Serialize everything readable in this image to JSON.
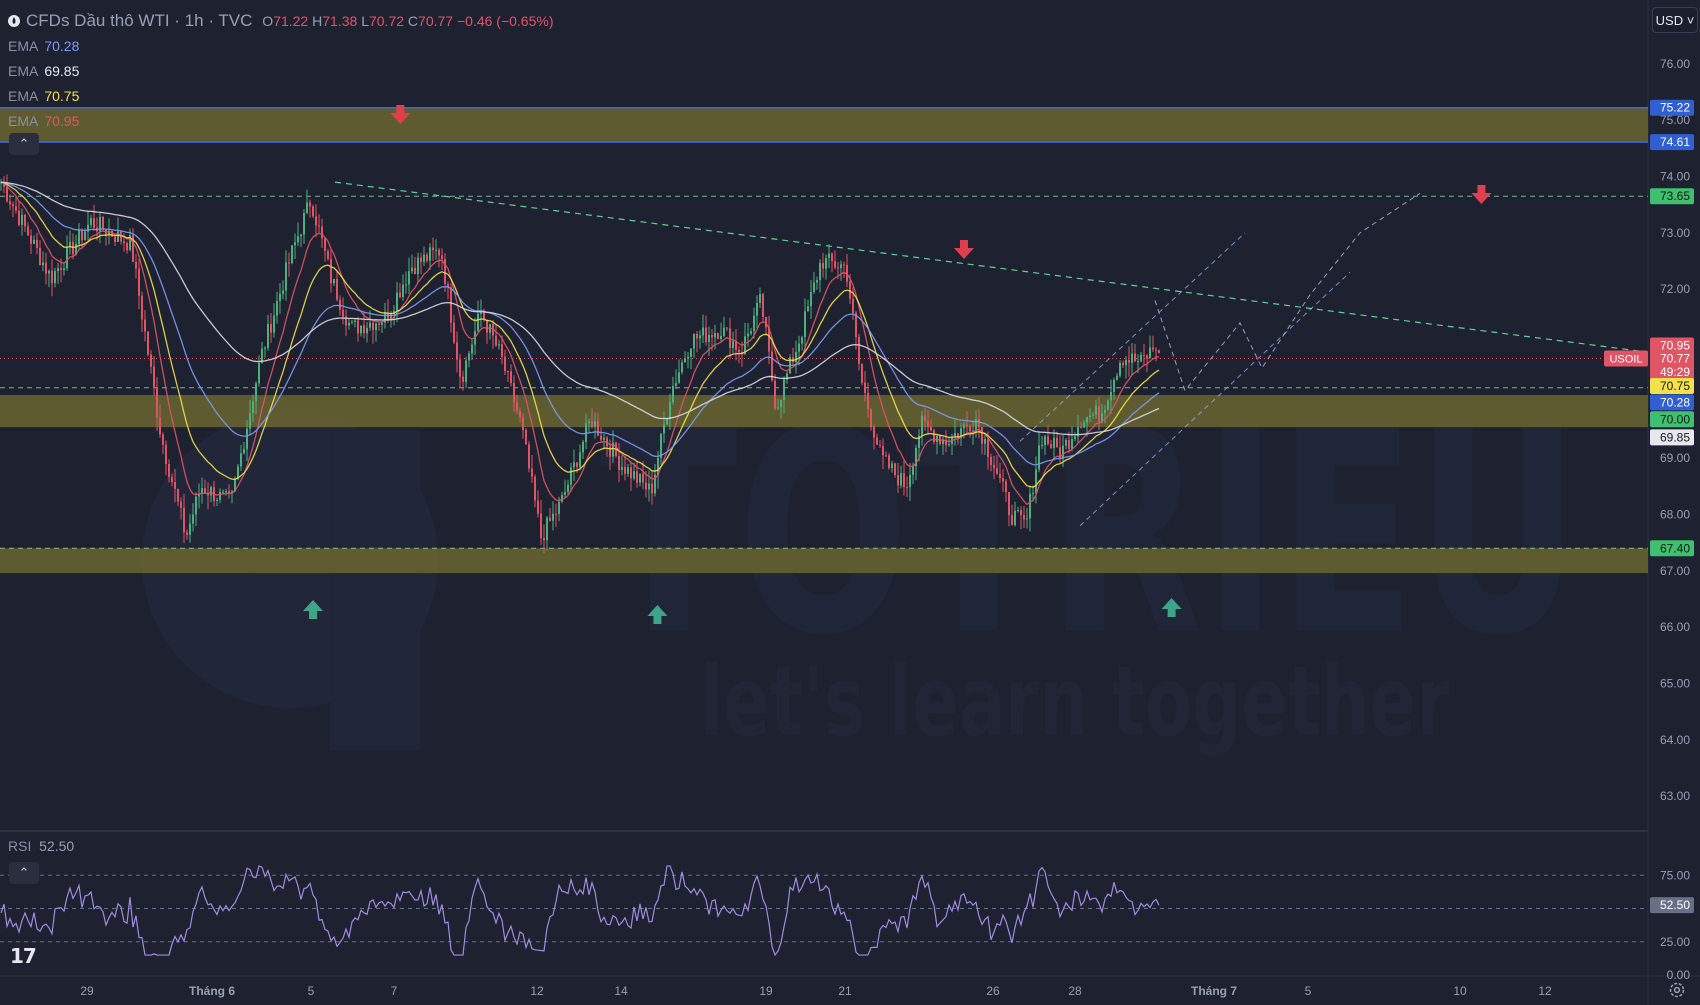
{
  "header": {
    "symbol_title": "CFDs Dầu thô WTI · 1h · TVC",
    "open_label": "O",
    "open_value": "71.22",
    "high_label": "H",
    "high_value": "71.38",
    "low_label": "L",
    "low_value": "70.72",
    "close_label": "C",
    "close_value": "70.77",
    "change": "−0.46 (−0.65%)"
  },
  "ema_legend": [
    {
      "label": "EMA",
      "value": "70.28",
      "color": "#7b9cf0"
    },
    {
      "label": "EMA",
      "value": "69.85",
      "color": "#e6e8f0"
    },
    {
      "label": "EMA",
      "value": "70.75",
      "color": "#f3e04b"
    },
    {
      "label": "EMA",
      "value": "70.95",
      "color": "#e05566"
    }
  ],
  "currency_button": "USD ˅",
  "collapse_icon": "chevron-up-icon",
  "rsi": {
    "label": "RSI",
    "value": "52.50"
  },
  "logo_text": "17",
  "watermark": {
    "brand": "TOTRIEU",
    "slogan": "let's learn together"
  },
  "colors": {
    "background": "#1e2130",
    "zone": "#6b6530",
    "up_candle": "#4caf7d",
    "down_candle": "#e05566",
    "ema_fast": "#e05566",
    "ema_mid": "#f3e04b",
    "ema_slow": "#7b9cf0",
    "ema_long": "#d8dae4",
    "trend_line": "#5fd09a",
    "arrow_up": "#3fa58a",
    "arrow_down": "#e0404e"
  },
  "chart_data": [
    {
      "type": "candlestick",
      "title": "CFDs Dầu thô WTI · 1h · TVC",
      "y_ticks": [
        "76.00",
        "75.00",
        "74.00",
        "73.00",
        "72.00",
        "71.00",
        "70.00",
        "69.00",
        "68.00",
        "67.00",
        "66.00",
        "65.00",
        "64.00",
        "63.00"
      ],
      "ylim": [
        62.4,
        76.6
      ],
      "x_ticks": [
        "29",
        "Tháng 6",
        "5",
        "7",
        "12",
        "14",
        "19",
        "21",
        "26",
        "28",
        "Tháng 7",
        "5",
        "10",
        "12"
      ],
      "close_anchors": [
        [
          0,
          73.9
        ],
        [
          50,
          72.2
        ],
        [
          90,
          73.2
        ],
        [
          130,
          72.8
        ],
        [
          160,
          69.4
        ],
        [
          185,
          67.6
        ],
        [
          200,
          68.5
        ],
        [
          230,
          68.2
        ],
        [
          260,
          70.8
        ],
        [
          290,
          72.6
        ],
        [
          310,
          73.6
        ],
        [
          330,
          72.2
        ],
        [
          350,
          71.3
        ],
        [
          385,
          71.5
        ],
        [
          410,
          72.4
        ],
        [
          440,
          72.7
        ],
        [
          460,
          70.4
        ],
        [
          480,
          71.6
        ],
        [
          500,
          70.8
        ],
        [
          520,
          69.6
        ],
        [
          540,
          67.6
        ],
        [
          560,
          68.2
        ],
        [
          590,
          69.7
        ],
        [
          620,
          68.9
        ],
        [
          650,
          68.4
        ],
        [
          670,
          70.2
        ],
        [
          690,
          71.1
        ],
        [
          720,
          71.3
        ],
        [
          740,
          70.9
        ],
        [
          760,
          71.8
        ],
        [
          775,
          69.9
        ],
        [
          800,
          71.2
        ],
        [
          820,
          72.5
        ],
        [
          845,
          72.4
        ],
        [
          860,
          70.4
        ],
        [
          880,
          69.0
        ],
        [
          905,
          68.5
        ],
        [
          920,
          69.6
        ],
        [
          945,
          69.3
        ],
        [
          975,
          69.7
        ],
        [
          995,
          68.8
        ],
        [
          1010,
          68.0
        ],
        [
          1025,
          67.8
        ],
        [
          1040,
          69.4
        ],
        [
          1060,
          69.1
        ],
        [
          1080,
          69.7
        ],
        [
          1100,
          69.8
        ],
        [
          1120,
          70.8
        ],
        [
          1140,
          70.7
        ],
        [
          1155,
          71.0
        ],
        [
          1158,
          70.77
        ]
      ],
      "ema_legend_values": [
        70.28,
        69.85,
        70.75,
        70.95
      ]
    },
    {
      "type": "line",
      "title": "RSI",
      "y_ticks": [
        "75.00",
        "50.00",
        "25.00",
        "0.00"
      ],
      "ylim": [
        0,
        100
      ],
      "last_value": 52.5
    }
  ],
  "price_labels": [
    {
      "text": "75.22",
      "price": 75.22,
      "bg": "#2f5fd0",
      "fg": "#ffffff"
    },
    {
      "text": "74.61",
      "price": 74.61,
      "bg": "#2f5fd0",
      "fg": "#ffffff"
    },
    {
      "text": "73.65",
      "price": 73.65,
      "bg": "#3fbf6f",
      "fg": "#0b1a10"
    },
    {
      "text": "70.95",
      "price": 71.0,
      "bg": "#e05566",
      "fg": "#ffffff"
    },
    {
      "text": "70.77",
      "price": 70.77,
      "bg": "#e05566",
      "fg": "#ffffff"
    },
    {
      "text": "49:29",
      "price": 70.53,
      "bg": "#e05566",
      "fg": "#ffffff"
    },
    {
      "text": "70.75",
      "price": 70.28,
      "bg": "#f3e04b",
      "fg": "#1a1a10"
    },
    {
      "text": "70.28",
      "price": 69.99,
      "bg": "#2f5fd0",
      "fg": "#ffffff"
    },
    {
      "text": "70.00",
      "price": 69.69,
      "bg": "#3fbf6f",
      "fg": "#0b1a10"
    },
    {
      "text": "69.85",
      "price": 69.37,
      "bg": "#e6e8f0",
      "fg": "#1a1a20"
    },
    {
      "text": "67.40",
      "price": 67.4,
      "bg": "#3fbf6f",
      "fg": "#0b1a10"
    }
  ],
  "usoil_tag": "USOIL",
  "rsi_value_tag": "52.50",
  "zones": [
    {
      "from": 74.61,
      "to": 75.22
    },
    {
      "from": 69.55,
      "to": 70.12
    },
    {
      "from": 66.96,
      "to": 67.4
    }
  ],
  "dashed_levels": [
    73.65,
    70.25,
    67.4
  ],
  "markers": [
    {
      "type": "down",
      "x_frac": 0.178
    },
    {
      "type": "down",
      "x_frac": 0.52
    },
    {
      "type": "down",
      "x_frac": 0.834
    },
    {
      "type": "up",
      "x_frac": 0.125
    },
    {
      "type": "up",
      "x_frac": 0.334
    },
    {
      "type": "up",
      "x_frac": 0.646
    }
  ]
}
